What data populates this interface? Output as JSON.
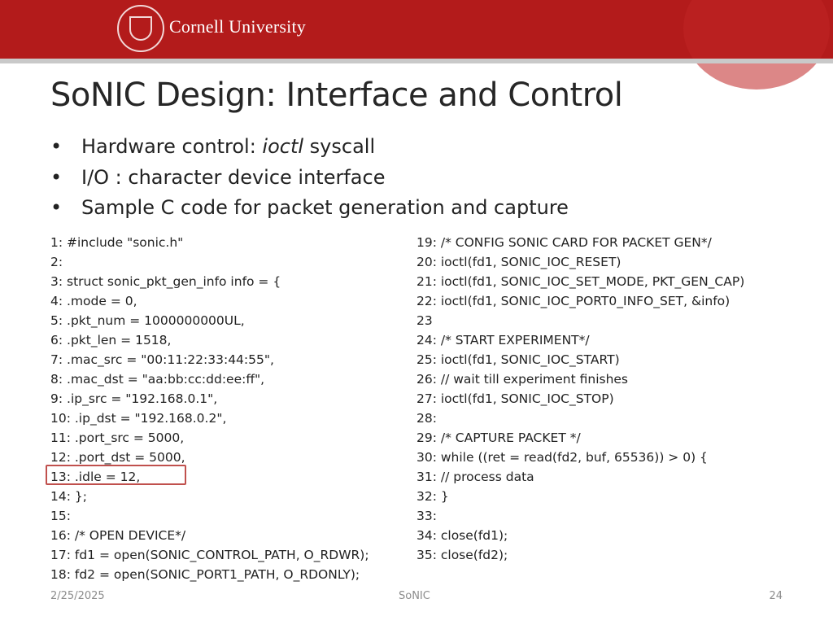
{
  "header": {
    "university": "Cornell University",
    "brand_color": "#b31b1b"
  },
  "slide": {
    "title": "SoNIC Design: Interface and Control",
    "bullets": [
      {
        "prefix": "Hardware control: ",
        "emph": "ioctl",
        "suffix": " syscall"
      },
      {
        "text": "I/O : character device interface"
      },
      {
        "text": "Sample C code for packet generation and capture"
      }
    ]
  },
  "code_left": [
    "1: #include \"sonic.h\"",
    "2:",
    "3: struct sonic_pkt_gen_info info = {",
    "4: .mode = 0,",
    "5: .pkt_num = 1000000000UL,",
    "6: .pkt_len = 1518,",
    "7: .mac_src = \"00:11:22:33:44:55\",",
    "8: .mac_dst = \"aa:bb:cc:dd:ee:ff\",",
    "9: .ip_src = \"192.168.0.1\",",
    "10: .ip_dst = \"192.168.0.2\",",
    "11: .port_src = 5000,",
    "12: .port_dst = 5000,",
    "13: .idle = 12,",
    "14: };",
    "15:",
    "16: /* OPEN DEVICE*/",
    "17: fd1 = open(SONIC_CONTROL_PATH, O_RDWR);",
    "18: fd2 = open(SONIC_PORT1_PATH, O_RDONLY);"
  ],
  "code_right": [
    "19: /* CONFIG SONIC CARD FOR PACKET GEN*/",
    "20: ioctl(fd1, SONIC_IOC_RESET)",
    "21: ioctl(fd1, SONIC_IOC_SET_MODE, PKT_GEN_CAP)",
    "22: ioctl(fd1, SONIC_IOC_PORT0_INFO_SET, &info)",
    "23",
    "24: /* START EXPERIMENT*/",
    "25: ioctl(fd1, SONIC_IOC_START)",
    "26: // wait till experiment finishes",
    "27: ioctl(fd1, SONIC_IOC_STOP)",
    "28:",
    "29: /* CAPTURE PACKET */",
    "30: while ((ret = read(fd2, buf, 65536)) > 0) {",
    "31: // process data",
    "32: }",
    "33:",
    "34: close(fd1);",
    "35: close(fd2);"
  ],
  "highlight": {
    "line": "13: .idle = 12,",
    "color": "#c0504d"
  },
  "footer": {
    "date": "2/25/2025",
    "center": "SoNIC",
    "page": "24"
  }
}
